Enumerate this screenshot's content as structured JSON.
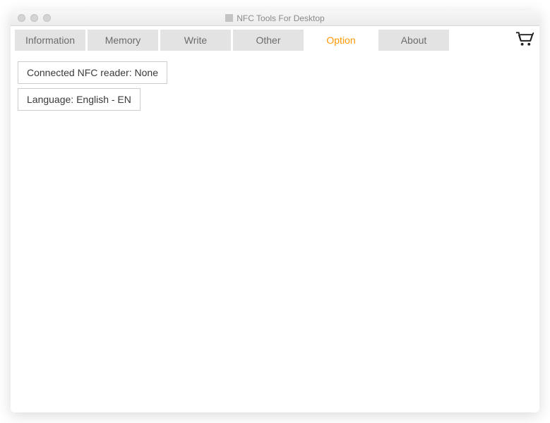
{
  "window": {
    "title": "NFC Tools For Desktop"
  },
  "tabs": {
    "information": "Information",
    "memory": "Memory",
    "write": "Write",
    "other": "Other",
    "option": "Option",
    "about": "About"
  },
  "options": {
    "connected_reader": "Connected NFC reader: None",
    "language": "Language: English - EN"
  }
}
